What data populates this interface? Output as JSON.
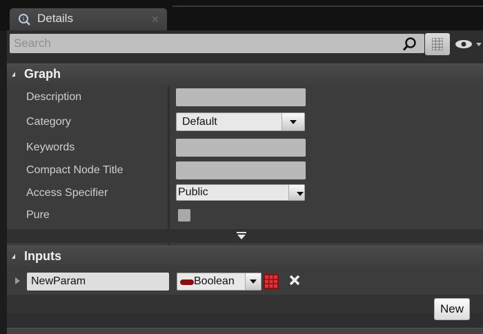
{
  "tab": {
    "icon": "details-icon",
    "title": "Details",
    "close_icon": "close-icon"
  },
  "search": {
    "placeholder": "Search",
    "value": "",
    "icon": "search-icon"
  },
  "toolbar": {
    "grid_icon": "property-matrix-icon",
    "eye_icon": "eye-icon"
  },
  "graph": {
    "title": "Graph",
    "properties": [
      {
        "label": "Description",
        "value": ""
      },
      {
        "label": "Category",
        "value": "Default"
      },
      {
        "label": "Keywords",
        "value": ""
      },
      {
        "label": "Compact Node Title",
        "value": ""
      },
      {
        "label": "Access Specifier",
        "value": "Public"
      },
      {
        "label": "Pure",
        "checked": false
      }
    ]
  },
  "inputs": {
    "title": "Inputs",
    "params": [
      {
        "name": "NewParam",
        "type": "Boolean",
        "type_color": "#8b0e0e"
      }
    ],
    "new_button": "New"
  }
}
